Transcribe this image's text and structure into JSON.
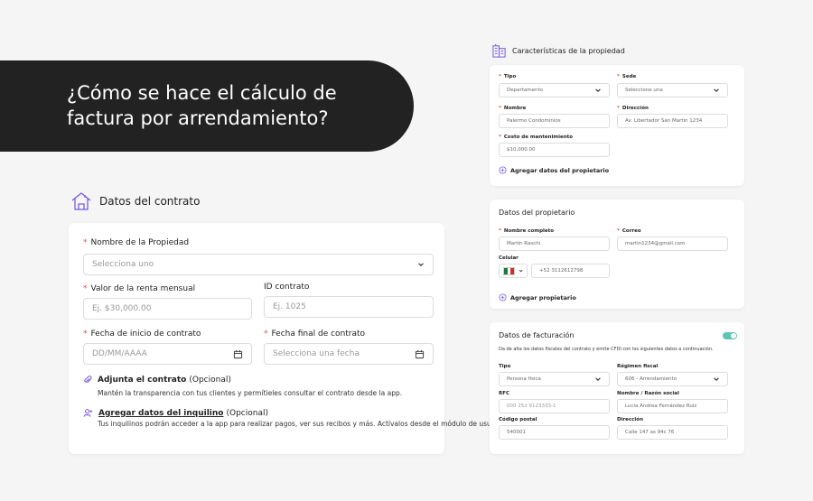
{
  "hero": {
    "title": "¿Cómo se hace el cálculo de factura por arrendamiento?"
  },
  "contrato": {
    "title": "Datos del contrato",
    "nombre_label": "Nombre de la Propiedad",
    "nombre_placeholder": "Selecciona uno",
    "renta_label": "Valor de la renta mensual",
    "renta_placeholder": "Ej. $30,000.00",
    "id_label": "ID contrato",
    "id_placeholder": "Ej. 1025",
    "inicio_label": "Fecha de inicio de contrato",
    "inicio_placeholder": "DD/MM/AAAA",
    "final_label": "Fecha final de contrato",
    "final_placeholder": "Selecciona una fecha",
    "adjunta_label": "Adjunta el contrato",
    "adjunta_optional": "(Opcional)",
    "adjunta_desc": "Mantén la transparencia con tus clientes y permítieles consultar el contrato desde la app.",
    "inquilino_label": "Agregar datos del inquilino",
    "inquilino_optional": "(Opcional)",
    "inquilino_desc": "Tus inquilinos podrán acceder a la app para realizar pagos, ver sus recibos y más. Actívalos desde el módulo de usuarios."
  },
  "caracteristicas": {
    "title": "Características de la propiedad",
    "tipo_label": "Tipo",
    "tipo_value": "Departamento",
    "sede_label": "Sede",
    "sede_value": "Seleccione una",
    "nombre_label": "Nombre",
    "nombre_value": "Palermo Condominios",
    "direccion_label": "Dirección",
    "direccion_value": "Av. Libertador San Martín 1234",
    "costo_label": "Costo de mantenimiento",
    "costo_value": "$10,000.00",
    "add_label": "Agregar datos del propietario"
  },
  "propietario": {
    "title": "Datos del propietario",
    "nombre_label": "Nombre completo",
    "nombre_value": "Martín Raschi",
    "correo_label": "Correo",
    "correo_value": "martin1234@gmail.com",
    "celular_label": "Celular",
    "celular_value": "+52 3112612798",
    "add_label": "Agregar propietario"
  },
  "facturacion": {
    "title": "Datos de facturación",
    "desc": "Da de alta los datos fiscales del contrato y emite CFDI con los siguientes datos a continuación.",
    "tipo_label": "Tipo",
    "tipo_value": "Persona física",
    "regimen_label": "Régimen fiscal",
    "regimen_value": "606 - Arrendamiento",
    "rfc_label": "RFC",
    "rfc_value": "000 252 9123333-1",
    "razon_label": "Nombre / Razón social",
    "razon_value": "Lucía Andrea Fernández Ruiz",
    "cp_label": "Código postal",
    "cp_value": "540001",
    "dir_label": "Dirección",
    "dir_value": "Calle 147 as 94c 76"
  },
  "colors": {
    "accent": "#7b5ce0",
    "toggle": "#5fc4b3",
    "required": "#e34a4a",
    "hero_bg": "#222222"
  },
  "icons": {
    "house": "house-icon",
    "building": "building-icon",
    "clip": "paperclip-icon",
    "user": "user-add-icon",
    "calendar": "calendar-icon",
    "plus": "plus-circle-icon",
    "flag": "mexico-flag-icon"
  }
}
